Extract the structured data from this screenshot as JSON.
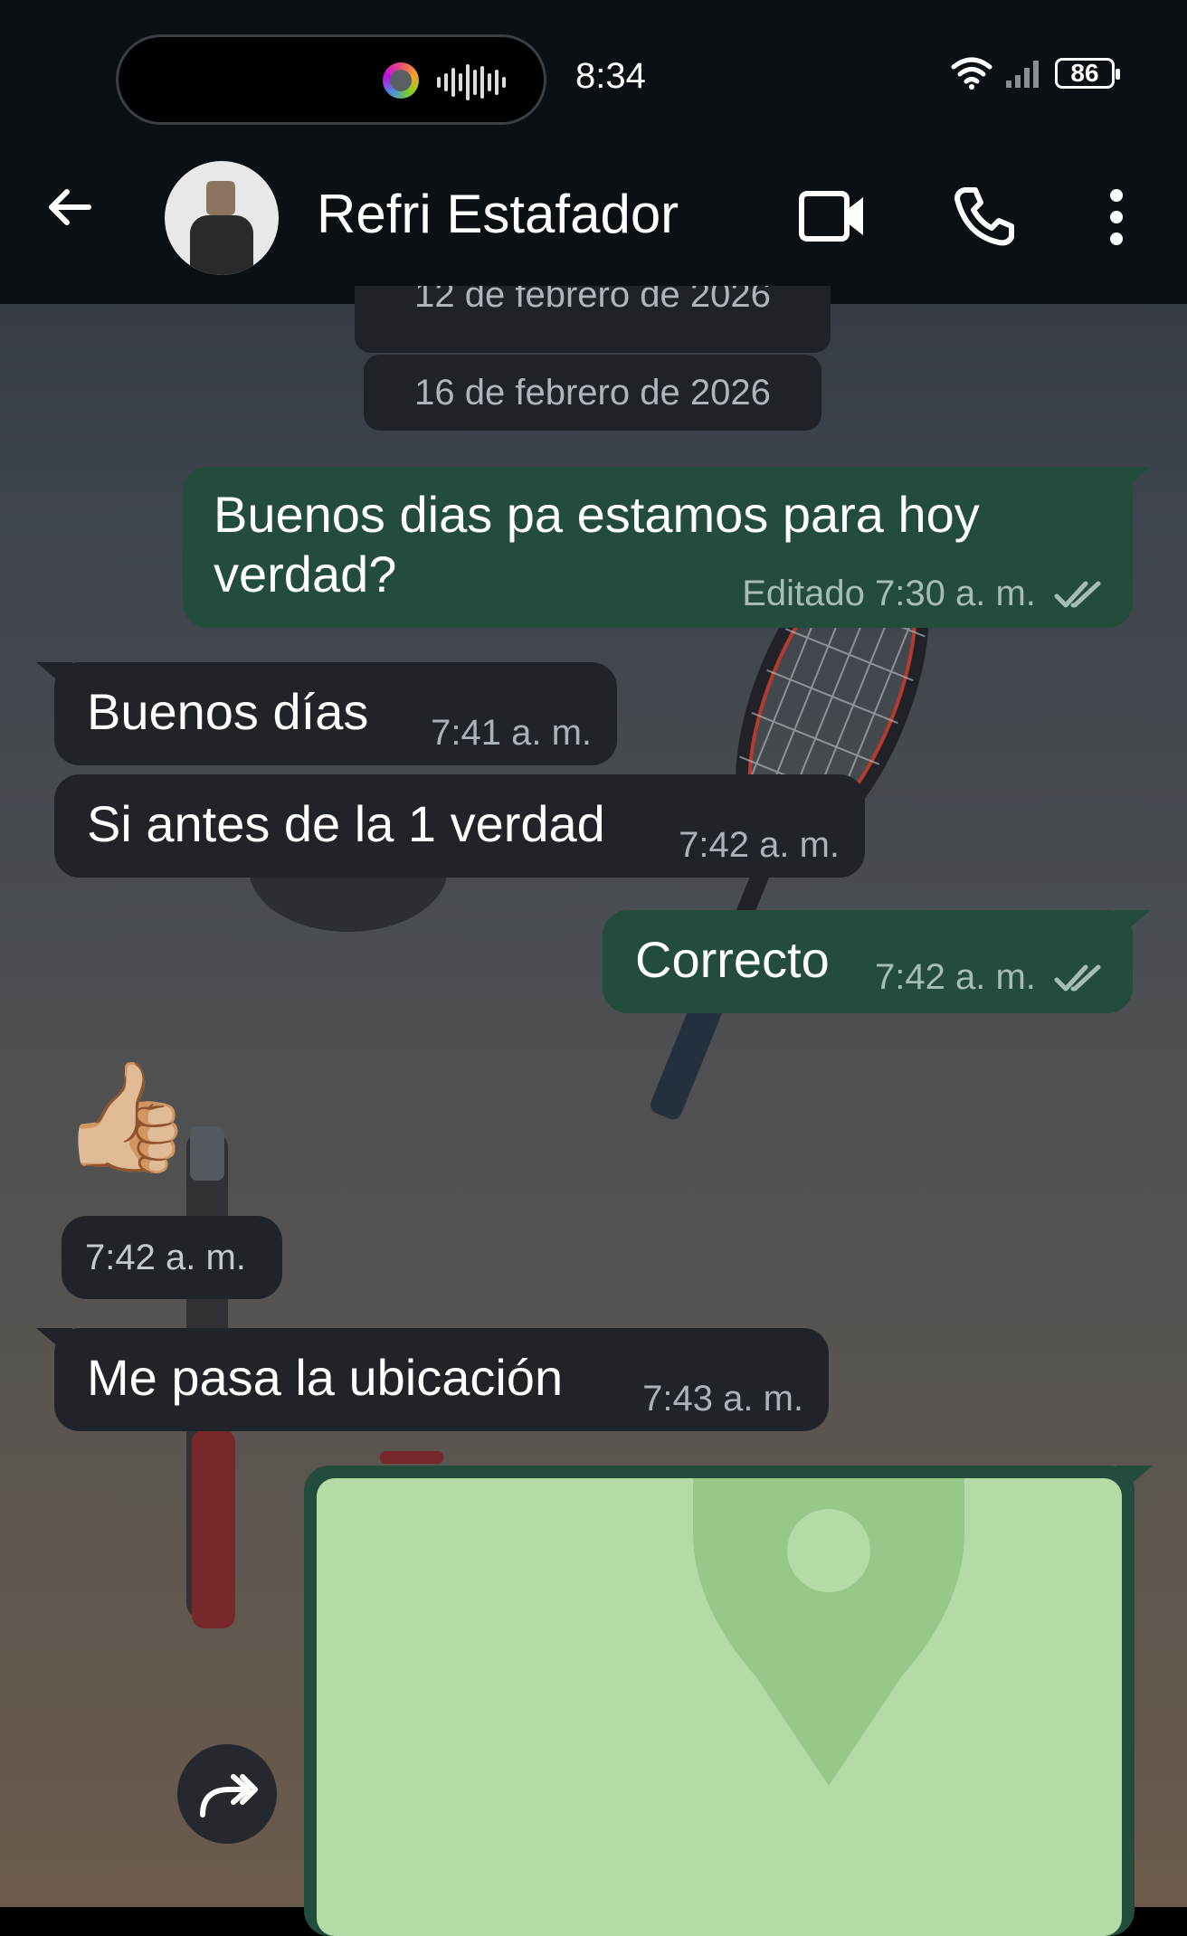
{
  "status_bar": {
    "time": "8:34",
    "battery": "86",
    "icons": [
      "app-indicator-icon",
      "audio-wave-icon",
      "wifi-icon",
      "signal-icon",
      "battery-icon"
    ]
  },
  "header": {
    "contact_name": "Refri Estafador",
    "actions": [
      "video-call-icon",
      "voice-call-icon",
      "more-options-icon"
    ]
  },
  "dates": {
    "partial": "12 de febrero de 2026",
    "current": "16 de febrero de 2026"
  },
  "messages": [
    {
      "direction": "out",
      "text_line1": "Buenos dias pa estamos para hoy",
      "text_line2": "verdad?",
      "edited": "Editado",
      "time": "7:30 a. m.",
      "status": "read"
    },
    {
      "direction": "in",
      "text": "Buenos días",
      "time": "7:41 a. m."
    },
    {
      "direction": "in",
      "text": "Si antes de la 1 verdad",
      "time": "7:42 a. m."
    },
    {
      "direction": "out",
      "text": "Correcto",
      "time": "7:42 a. m.",
      "status": "read"
    },
    {
      "direction": "in",
      "type": "sticker",
      "emoji": "👍🏼",
      "time": "7:42 a. m."
    },
    {
      "direction": "in",
      "text": "Me pasa la ubicación",
      "time": "7:43 a. m."
    },
    {
      "direction": "out",
      "type": "location"
    }
  ],
  "colors": {
    "incoming_bubble": "#202327",
    "outgoing_bubble": "#234c3c",
    "map_bg": "#b2dba6",
    "pin": "#98c78a"
  }
}
